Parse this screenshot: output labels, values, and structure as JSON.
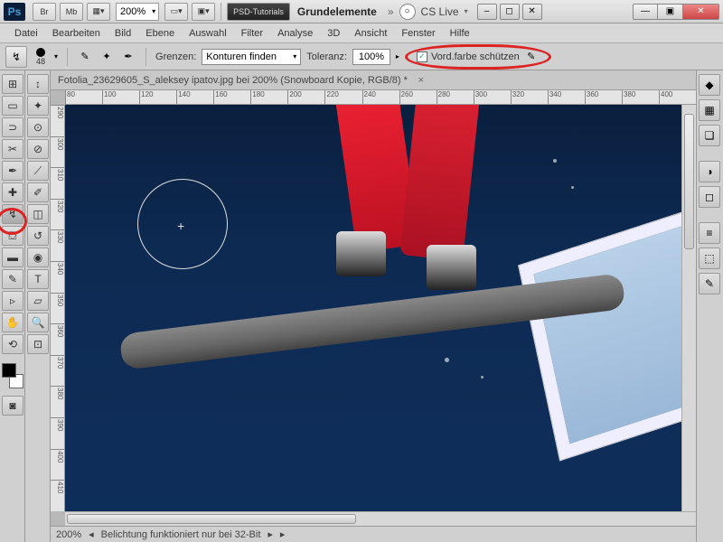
{
  "titlebar": {
    "ps_logo": "Ps",
    "br": "Br",
    "mb": "Mb",
    "zoom": "200%",
    "workspace1": "PSD-Tutorials",
    "workspace2": "Grundelemente",
    "cslive": "CS Live"
  },
  "menu": [
    "Datei",
    "Bearbeiten",
    "Bild",
    "Ebene",
    "Auswahl",
    "Filter",
    "Analyse",
    "3D",
    "Ansicht",
    "Fenster",
    "Hilfe"
  ],
  "options": {
    "brush_size": "48",
    "grenzen_label": "Grenzen:",
    "grenzen_value": "Konturen finden",
    "toleranz_label": "Toleranz:",
    "toleranz_value": "100%",
    "checkbox_checked": "✓",
    "protect_label": "Vord.farbe schützen"
  },
  "document": {
    "tab": "Fotolia_23629605_S_aleksey ipatov.jpg bei 200% (Snowboard Kopie, RGB/8) *"
  },
  "ruler_h": [
    "80",
    "100",
    "120",
    "140",
    "160",
    "180",
    "200",
    "220",
    "240",
    "260",
    "280",
    "300",
    "320",
    "340",
    "360",
    "380",
    "400"
  ],
  "ruler_v": [
    "290",
    "300",
    "310",
    "320",
    "330",
    "340",
    "350",
    "360",
    "370",
    "380",
    "390",
    "400",
    "410"
  ],
  "status": {
    "zoom": "200%",
    "info": "Belichtung funktioniert nur bei 32-Bit"
  }
}
